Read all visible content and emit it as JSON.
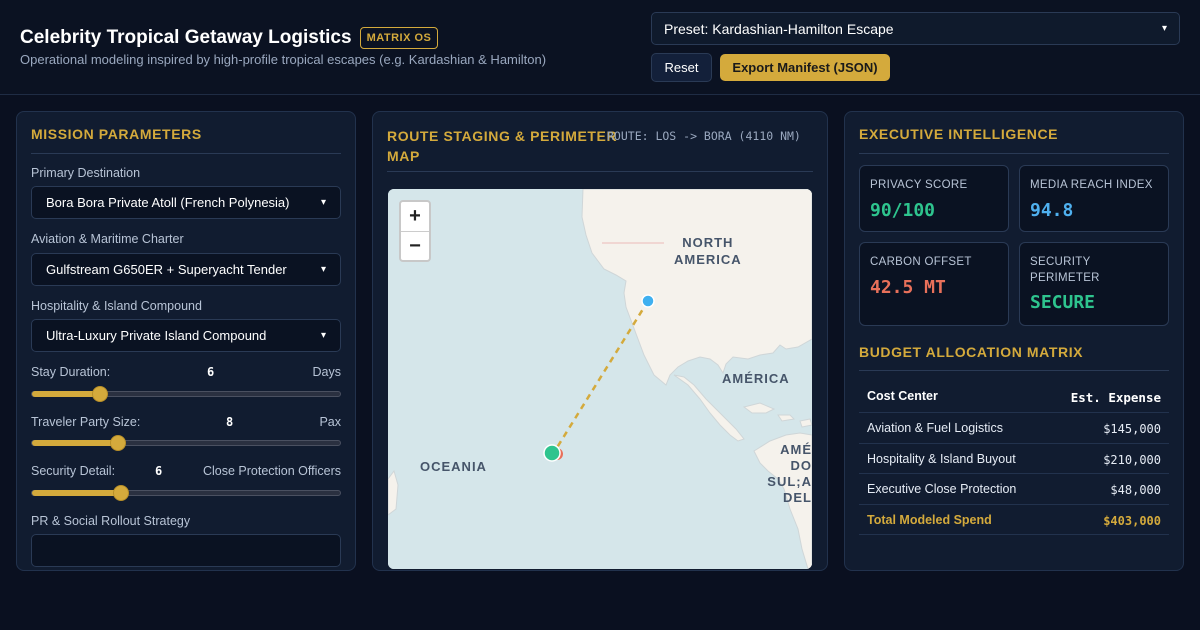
{
  "header": {
    "title": "Celebrity Tropical Getaway Logistics",
    "badge": "MATRIX OS",
    "subtitle": "Operational modeling inspired by high-profile tropical escapes (e.g. Kardashian & Hamilton)",
    "preset_value": "Preset: Kardashian-Hamilton Escape",
    "reset_label": "Reset",
    "export_label": "Export Manifest (JSON)"
  },
  "mission": {
    "title": "MISSION PARAMETERS",
    "destination_label": "Primary Destination",
    "destination_value": "Bora Bora Private Atoll (French Polynesia)",
    "charter_label": "Aviation & Maritime Charter",
    "charter_value": "Gulfstream G650ER + Superyacht Tender",
    "hospitality_label": "Hospitality & Island Compound",
    "hospitality_value": "Ultra-Luxury Private Island Compound",
    "stay_label": "Stay Duration:",
    "stay_value": "6",
    "stay_unit": "Days",
    "stay_level": 0.22,
    "party_label": "Traveler Party Size:",
    "party_value": "8",
    "party_unit": "Pax",
    "party_level": 0.28,
    "security_label": "Security Detail:",
    "security_value": "6",
    "security_unit": "Close Protection Officers",
    "security_level": 0.29,
    "pr_label": "PR & Social Rollout Strategy"
  },
  "route": {
    "title_line1": "ROUTE STAGING & PERIMETER",
    "title_line2": "MAP",
    "route_label": "ROUTE: LOS -> BORA (4110 NM)",
    "zoom_in": "+",
    "zoom_out": "−",
    "labels": {
      "north_america_1": "NORTH",
      "north_america_2": "AMERICA",
      "america": "AMÉRICA",
      "oceania": "OCEANIA",
      "sud_1": "AMÉ",
      "sud_2": "DO SUL;A",
      "sud_3": "DEL"
    }
  },
  "intel": {
    "title": "EXECUTIVE INTELLIGENCE",
    "privacy_label": "PRIVACY SCORE",
    "privacy_value": "90/100",
    "media_label": "MEDIA REACH INDEX",
    "media_value": "94.8",
    "carbon_label": "CARBON OFFSET",
    "carbon_value": "42.5 MT",
    "security_label_1": "SECURITY",
    "security_label_2": "PERIMETER",
    "security_value": "SECURE",
    "colors": {
      "privacy": "#2ec48e",
      "media": "#4fb0ef",
      "carbon": "#e8705a",
      "secure": "#2ec48e"
    }
  },
  "budget": {
    "title": "BUDGET ALLOCATION MATRIX",
    "head_center": "Cost Center",
    "head_expense": "Est. Expense",
    "rows": [
      {
        "center": "Aviation & Fuel Logistics",
        "expense": "$145,000"
      },
      {
        "center": "Hospitality & Island Buyout",
        "expense": "$210,000"
      },
      {
        "center": "Executive Close Protection",
        "expense": "$48,000"
      }
    ],
    "total_label": "Total Modeled Spend",
    "total_value": "$403,000"
  }
}
